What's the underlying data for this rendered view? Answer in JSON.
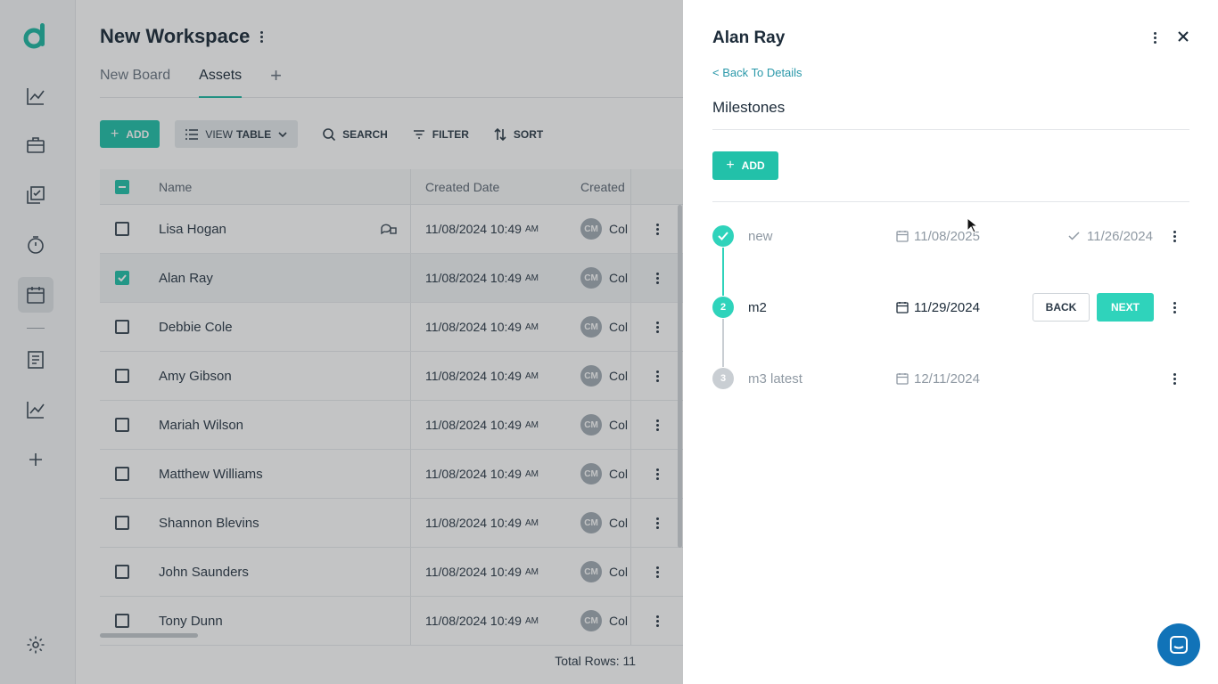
{
  "workspace": {
    "title": "New Workspace"
  },
  "tabs": [
    {
      "label": "New Board"
    },
    {
      "label": "Assets"
    }
  ],
  "toolbar": {
    "add_label": "ADD",
    "view_prefix": "VIEW",
    "view_value": "TABLE",
    "search_label": "SEARCH",
    "filter_label": "FILTER",
    "sort_label": "SORT"
  },
  "table": {
    "columns": {
      "name": "Name",
      "created_date": "Created Date",
      "created_by": "Created"
    },
    "rows": [
      {
        "name": "Lisa Hogan",
        "date": "11/08/2024 10:49",
        "ampm": "AM",
        "initials": "CM",
        "by": "Col",
        "checked": false
      },
      {
        "name": "Alan Ray",
        "date": "11/08/2024 10:49",
        "ampm": "AM",
        "initials": "CM",
        "by": "Col",
        "checked": true
      },
      {
        "name": "Debbie Cole",
        "date": "11/08/2024 10:49",
        "ampm": "AM",
        "initials": "CM",
        "by": "Col",
        "checked": false
      },
      {
        "name": "Amy Gibson",
        "date": "11/08/2024 10:49",
        "ampm": "AM",
        "initials": "CM",
        "by": "Col",
        "checked": false
      },
      {
        "name": "Mariah Wilson",
        "date": "11/08/2024 10:49",
        "ampm": "AM",
        "initials": "CM",
        "by": "Col",
        "checked": false
      },
      {
        "name": "Matthew Williams",
        "date": "11/08/2024 10:49",
        "ampm": "AM",
        "initials": "CM",
        "by": "Col",
        "checked": false
      },
      {
        "name": "Shannon Blevins",
        "date": "11/08/2024 10:49",
        "ampm": "AM",
        "initials": "CM",
        "by": "Col",
        "checked": false
      },
      {
        "name": "John Saunders",
        "date": "11/08/2024 10:49",
        "ampm": "AM",
        "initials": "CM",
        "by": "Col",
        "checked": false
      },
      {
        "name": "Tony Dunn",
        "date": "11/08/2024 10:49",
        "ampm": "AM",
        "initials": "CM",
        "by": "Col",
        "checked": false
      }
    ],
    "total_rows": "Total Rows: 11"
  },
  "panel": {
    "title": "Alan Ray",
    "back_link": "< Back To Details",
    "section_title": "Milestones",
    "add_label": "ADD",
    "milestones": [
      {
        "step": "",
        "name": "new",
        "date": "11/08/2025",
        "completed_date": "11/26/2024",
        "state": "done"
      },
      {
        "step": "2",
        "name": "m2",
        "date": "11/29/2024",
        "state": "current",
        "back_label": "BACK",
        "next_label": "NEXT"
      },
      {
        "step": "3",
        "name": "m3 latest",
        "date": "12/11/2024",
        "state": "upcoming"
      }
    ]
  },
  "colors": {
    "accent": "#22c1a9",
    "brand": "#1fb8a2",
    "chat": "#1173b8"
  },
  "icons": {
    "rail": [
      "logo-icon",
      "analytics-icon",
      "briefcase-icon",
      "tasks-icon",
      "timer-icon",
      "calendar-icon",
      "document-icon",
      "chart-icon",
      "plus-icon",
      "settings-icon"
    ]
  }
}
